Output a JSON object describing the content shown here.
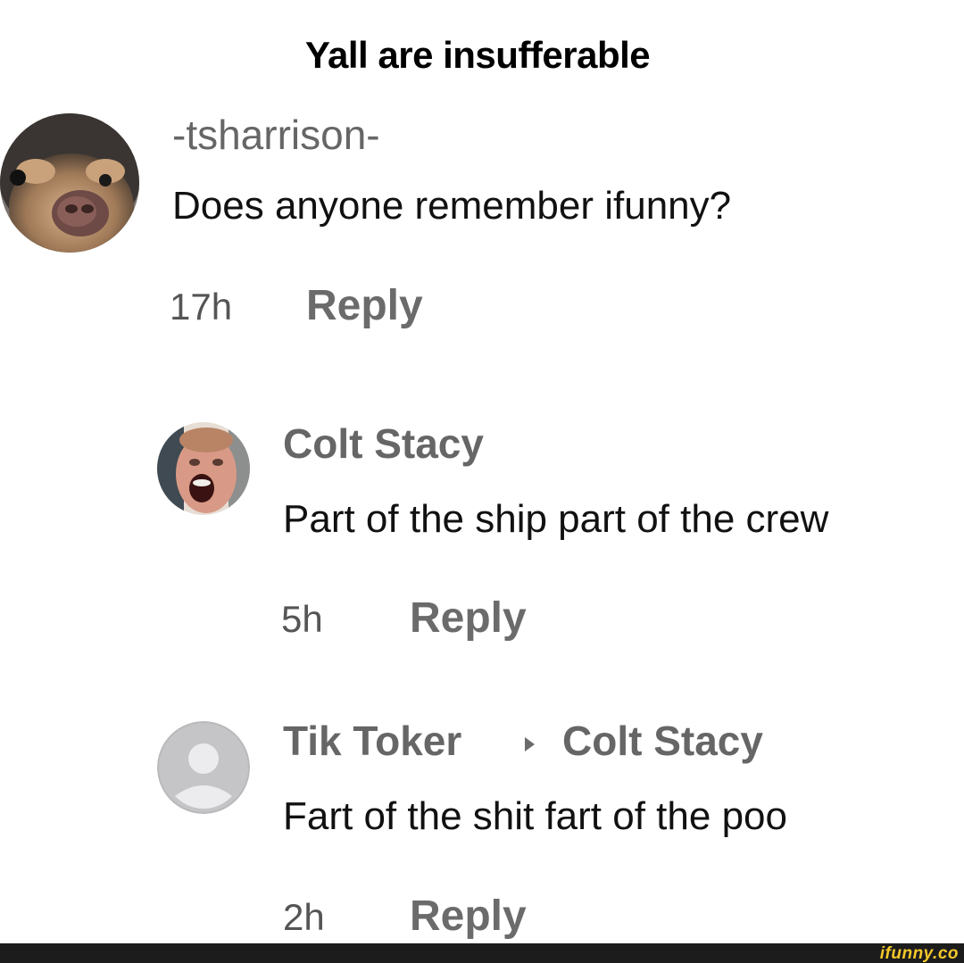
{
  "post": {
    "title": "Yall are insufferable"
  },
  "comments": [
    {
      "author": "-tsharrison-",
      "text": "Does anyone remember ifunny?",
      "time": "17h",
      "reply_label": "Reply",
      "avatar_icon": "dog-avatar"
    },
    {
      "author": "Colt Stacy",
      "text": "Part of the ship part of the crew",
      "time": "5h",
      "reply_label": "Reply",
      "avatar_icon": "man-avatar"
    },
    {
      "author": "Tik Toker",
      "reply_to": "Colt Stacy",
      "text": "Fart of the shit fart of the poo",
      "time": "2h",
      "reply_label": "Reply",
      "avatar_icon": "default-user-avatar"
    }
  ],
  "watermark": {
    "text": "ifunny.co",
    "color": "#f4c82a"
  },
  "colors": {
    "name_gray": "#666666",
    "reply_gray": "#6b6b6b",
    "text_black": "#111111",
    "footer_bar": "#1c1c1c"
  }
}
